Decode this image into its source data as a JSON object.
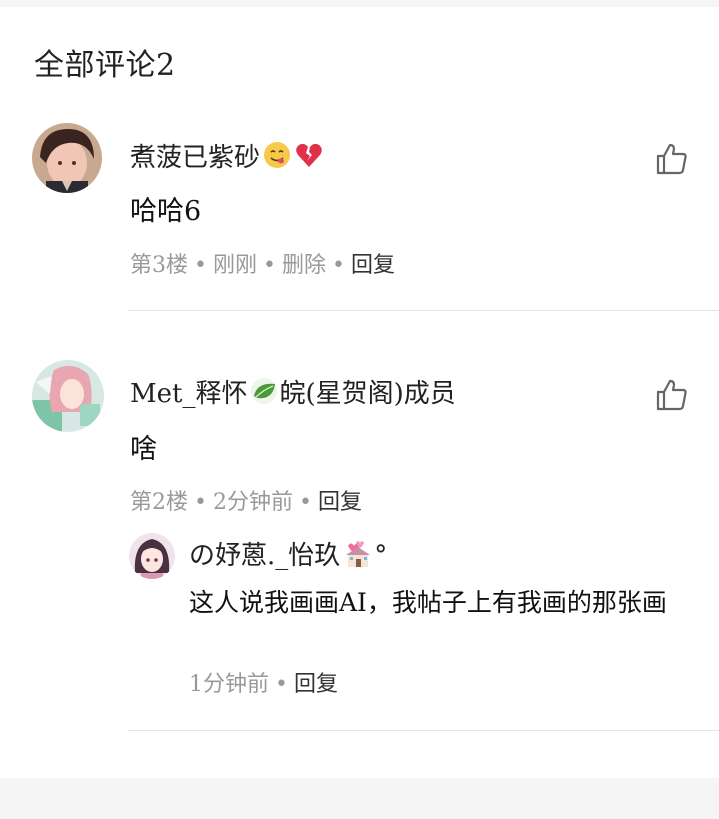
{
  "section": {
    "title": "全部评论2"
  },
  "comments": [
    {
      "username": "煮菠已紫砂",
      "emoji_icons": [
        "yum-face-emoji",
        "broken-heart-emoji"
      ],
      "content": "哈哈6",
      "floor": "第3楼",
      "time": "刚刚",
      "delete_label": "删除",
      "reply_label": "回复"
    },
    {
      "username": "Met_释怀",
      "badge_icon": "leaf-emoji",
      "group": "皖(星贺阁)成员",
      "content": "啥",
      "floor": "第2楼",
      "time": "2分钟前",
      "reply_label": "回复",
      "sub_reply": {
        "username": "の妤蒽._怡玖",
        "emoji_icons": [
          "wedding-chapel-emoji"
        ],
        "suffix": "°",
        "content": "这人说我画画AI，我帖子上有我画的那张画",
        "time": "1分钟前",
        "reply_label": "回复"
      }
    }
  ],
  "colors": {
    "background": "#f5f5f5",
    "card": "#ffffff",
    "meta_text": "#999999",
    "primary_text": "#222222",
    "divider": "#e6e6e6"
  }
}
